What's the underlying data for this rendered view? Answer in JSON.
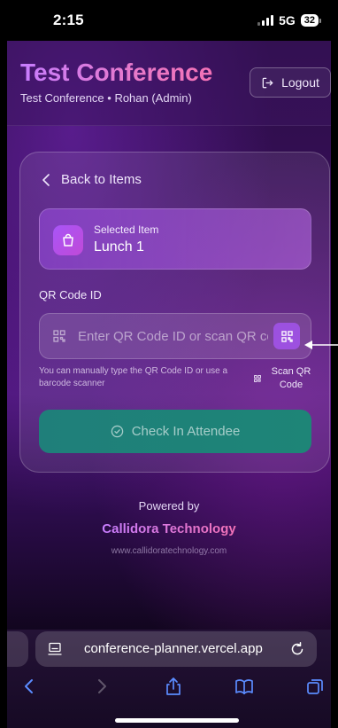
{
  "status_bar": {
    "time": "2:15",
    "network": "5G",
    "battery": "32"
  },
  "header": {
    "title": "Test Conference",
    "subtitle": "Test Conference • Rohan (Admin)",
    "logout_label": "Logout"
  },
  "card": {
    "back_label": "Back to Items",
    "selected_item": {
      "label": "Selected Item",
      "value": "Lunch 1"
    },
    "qr": {
      "label": "QR Code ID",
      "value": "",
      "placeholder": "Enter QR Code ID or scan QR code",
      "help_text": "You can manually type the QR Code ID or use a barcode scanner",
      "scan_link_label": "Scan QR Code"
    },
    "checkin_label": "Check In Attendee"
  },
  "footer": {
    "powered_by": "Powered by",
    "brand": "Callidora Technology",
    "website": "www.callidoratechnology.com"
  },
  "browser": {
    "url": "conference-planner.vercel.app"
  },
  "icons": {
    "logout": "logout-icon",
    "back": "chevron-left-icon",
    "item": "shopping-bag-icon",
    "qr": "qr-code-icon",
    "checkin": "check-circle-icon",
    "page": "page-icon",
    "reload": "reload-icon"
  },
  "colors": {
    "accent_purple": "#a855f7",
    "accent_pink": "#f472b6",
    "checkin_green": "#1f7f7a"
  }
}
